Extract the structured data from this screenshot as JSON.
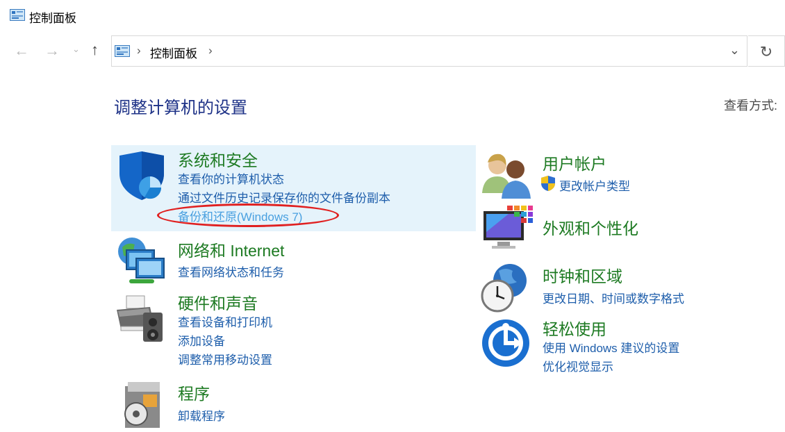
{
  "window": {
    "title": "控制面板"
  },
  "nav": {
    "back": "←",
    "forward": "→",
    "recent": "⌄",
    "up": "↑",
    "address": {
      "crumb": "控制面板",
      "sep1": "›",
      "sep2": "›",
      "dropdown": "⌄"
    },
    "refresh": "↻"
  },
  "main": {
    "heading": "调整计算机的设置",
    "view_by": "查看方式:",
    "categories_left": [
      {
        "title": "系统和安全",
        "icon": "shield-icon",
        "links": [
          "查看你的计算机状态",
          "通过文件历史记录保存你的文件备份副本",
          "备份和还原(Windows 7)"
        ]
      },
      {
        "title": "网络和 Internet",
        "icon": "network-globe-icon",
        "links": [
          "查看网络状态和任务"
        ]
      },
      {
        "title": "硬件和声音",
        "icon": "printer-speaker-icon",
        "links": [
          "查看设备和打印机",
          "添加设备",
          "调整常用移动设置"
        ]
      },
      {
        "title": "程序",
        "icon": "programs-disc-icon",
        "links": [
          "卸载程序"
        ]
      }
    ],
    "categories_right": [
      {
        "title": "用户帐户",
        "icon": "users-icon",
        "links": [
          "更改帐户类型"
        ]
      },
      {
        "title": "外观和个性化",
        "icon": "monitor-palette-icon",
        "links": []
      },
      {
        "title": "时钟和区域",
        "icon": "clock-globe-icon",
        "links": [
          "更改日期、时间或数字格式"
        ]
      },
      {
        "title": "轻松使用",
        "icon": "ease-of-access-icon",
        "links": [
          "使用 Windows 建议的设置",
          "优化视觉显示"
        ]
      }
    ]
  },
  "colors": {
    "heading": "#1e3287",
    "category_title": "#1d7a22",
    "link": "#1e5eab",
    "highlight": "#e5f3fb",
    "annotation": "#e02020"
  }
}
